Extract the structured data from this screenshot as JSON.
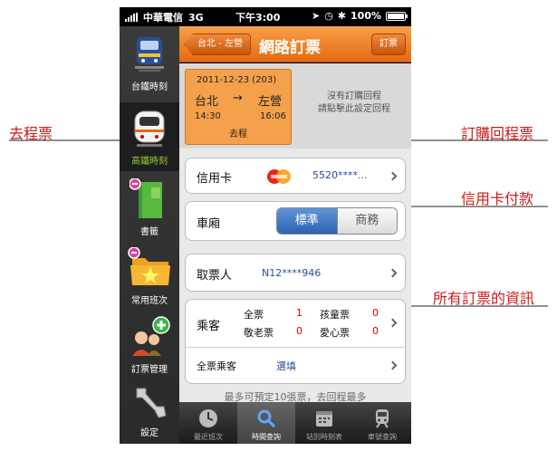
{
  "status_bar": {
    "carrier": "中華電信",
    "network": "3G",
    "time": "下午3:00",
    "battery": "100%"
  },
  "sidebar": {
    "items": [
      {
        "label": "台鐵時刻",
        "icon": "train-icon",
        "active": false
      },
      {
        "label": "高鐵時刻",
        "icon": "high-speed-rail-icon",
        "active": true
      },
      {
        "label": "書籤",
        "icon": "bookmark-icon",
        "active": false
      },
      {
        "label": "常用班次",
        "icon": "favorite-folder-icon",
        "active": false
      },
      {
        "label": "訂票管理",
        "icon": "users-add-icon",
        "active": false
      },
      {
        "label": "設定",
        "icon": "wrench-icon",
        "active": false
      }
    ]
  },
  "header": {
    "route_button": "台北 - 左營",
    "title": "網路訂票",
    "book_button": "訂票"
  },
  "outbound": {
    "date": "2011-12-23 (203)",
    "from": "台北",
    "arrow": "→",
    "to": "左營",
    "depart": "14:30",
    "arrive": "16:06",
    "leg_label": "去程"
  },
  "return_hint": {
    "line1": "沒有訂購回程",
    "line2": "請點擊此設定回程"
  },
  "credit_card": {
    "label": "信用卡",
    "number": "5520****..."
  },
  "car": {
    "label": "車廂",
    "options": [
      "標準",
      "商務"
    ],
    "selected": "標準"
  },
  "pickup": {
    "label": "取票人",
    "id": "N12****946"
  },
  "passengers": {
    "label": "乘客",
    "types": [
      {
        "name": "全票",
        "count": "1"
      },
      {
        "name": "孩童票",
        "count": "0"
      },
      {
        "name": "敬老票",
        "count": "0"
      },
      {
        "name": "愛心票",
        "count": "0"
      }
    ],
    "all_passengers_label": "全票乘客",
    "all_passengers_value": "選填"
  },
  "note": "最多可預定10張票，去回程最多",
  "tabbar": {
    "tabs": [
      {
        "label": "最近班次",
        "icon": "clock-icon",
        "active": false
      },
      {
        "label": "時間查詢",
        "icon": "search-icon",
        "active": true
      },
      {
        "label": "站別時刻表",
        "icon": "calendar-icon",
        "active": false
      },
      {
        "label": "車號查詢",
        "icon": "train-front-icon",
        "active": false
      }
    ]
  },
  "annotations": {
    "outbound_ticket": "去程票",
    "return_ticket": "訂購回程票",
    "credit_payment": "信用卡付款",
    "ticket_info": "所有訂票的資訊"
  },
  "colors": {
    "header_orange": "#e46a10",
    "outbound_orange": "#f5a04a",
    "segment_blue": "#2e62b2",
    "annotation_red": "#cc1a1a",
    "active_green": "#9acd32"
  }
}
